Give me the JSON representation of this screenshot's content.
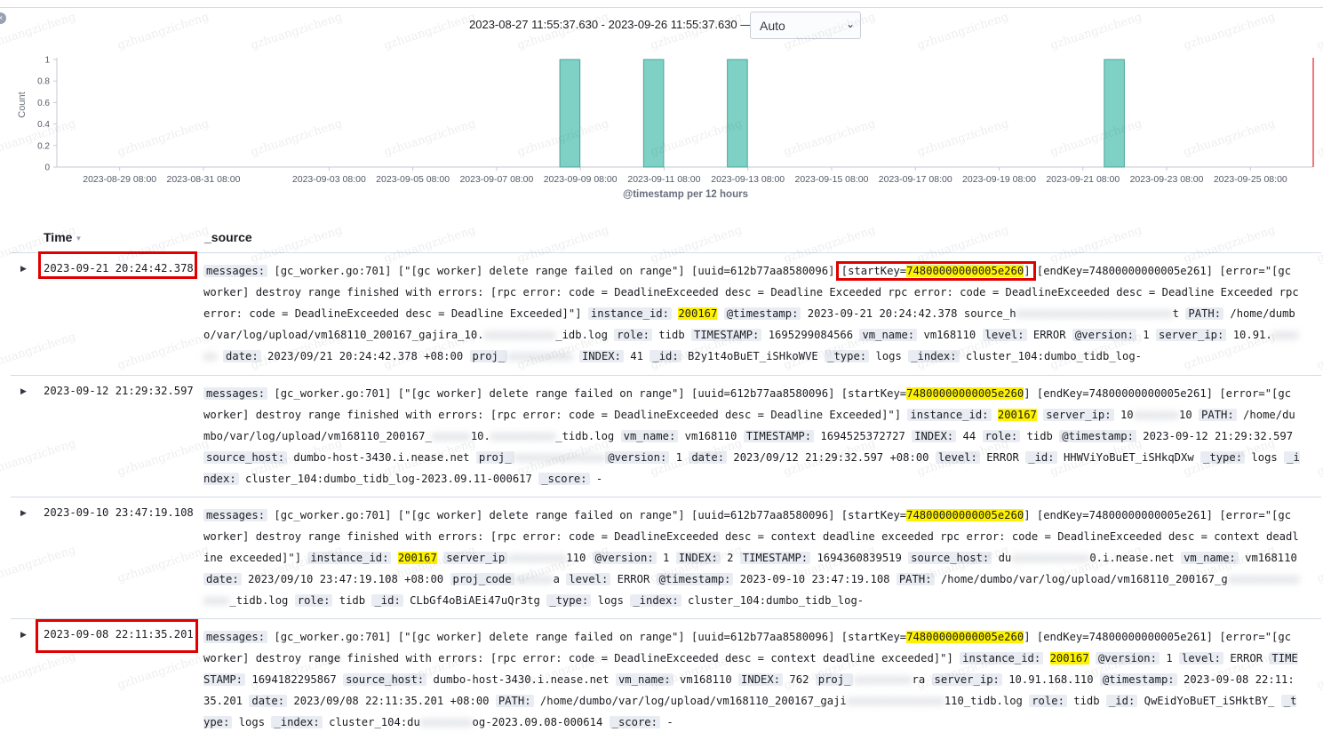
{
  "header": {
    "time_range": "2023-08-27 11:55:37.630 - 2023-09-26 11:55:37.630 —",
    "interval_value": "Auto",
    "clear_glyph": "×"
  },
  "chart_data": {
    "type": "bar",
    "ylabel": "Count",
    "xlabel": "@timestamp per 12 hours",
    "ylim": [
      0,
      1
    ],
    "y_ticks": [
      "0",
      "0.2",
      "0.4",
      "0.6",
      "0.8",
      "1"
    ],
    "x_ticks": [
      "2023-08-29 08:00",
      "2023-08-31 08:00",
      "2023-09-03 08:00",
      "2023-09-05 08:00",
      "2023-09-07 08:00",
      "2023-09-09 08:00",
      "2023-09-11 08:00",
      "2023-09-13 08:00",
      "2023-09-15 08:00",
      "2023-09-17 08:00",
      "2023-09-19 08:00",
      "2023-09-21 08:00",
      "2023-09-23 08:00",
      "2023-09-25 08:00"
    ],
    "bars": [
      {
        "x": "2023-09-08 20:00",
        "value": 1
      },
      {
        "x": "2023-09-10 20:00",
        "value": 1
      },
      {
        "x": "2023-09-12 20:00",
        "value": 1
      },
      {
        "x": "2023-09-21 20:00",
        "value": 1
      }
    ],
    "bar_color": "#7fd1c5",
    "bar_stroke": "#4aa59a",
    "now_line_color": "#f04e4e"
  },
  "table": {
    "columns": {
      "time": "Time",
      "source": "_source"
    },
    "sort_glyph": "▼",
    "expand_glyph": "▶",
    "watermark": "gzhuangzicheng"
  },
  "rows": [
    {
      "time": "2023-09-21 20:24:42.378",
      "messages_a": " [gc_worker.go:701] [\"[gc worker] delete range failed on range\"] [uuid=612b77aa8580096] ",
      "start_prefix": "[startKey=",
      "start_key": "74800000000005e260",
      "start_suffix": "]",
      "messages_b": " [endKey=74800000000005e261] [error=\"[gc worker] destroy range finished with errors: [rpc error: code = DeadlineExceeded desc = Deadline Exceeded rpc error: code = DeadlineExceeded desc = Deadline Exceeded rpc error: code = DeadlineExceeded desc = Deadline Exceeded]\"] ",
      "instance_id": "200167",
      "timestamp": " 2023-09-21 20:24:42.378 ",
      "source_host_partial": "source_h",
      "source_host_tail": "t",
      "path": " /home/dumbo/var/log/upload/vm168110_200167_gajira_10.",
      "path_tail": "_idb.log ",
      "role": " tidb ",
      "ts_num": " 1695299084566 ",
      "vm_name": " vm168110 ",
      "level": " ERROR ",
      "version": " 1 ",
      "server_ip": " 10.91.",
      "date": " 2023/09/21 20:24:42.378 +08:00 ",
      "proj_partial": "proj_",
      "index_num": " 41 ",
      "id": " B2y1t4oBuET_iSHkoWVE ",
      "type": " logs ",
      "index_val": " cluster_104:dumbo_tidb_log-"
    },
    {
      "time": "2023-09-12 21:29:32.597",
      "messages_a": " [gc_worker.go:701] [\"[gc worker] delete range failed on range\"] [uuid=612b77aa8580096] [startKey=",
      "start_key": "74800000000005e260",
      "messages_b": "] [endKey=74800000000005e261] [error=\"[gc worker] destroy range finished with errors: [rpc error: code = DeadlineExceeded desc = Deadline Exceeded]\"] ",
      "instance_id": "200167",
      "server_ip": " 10",
      "server_ip_tail": "10",
      "path": " /home/dumbo/var/log/upload/vm168110_200167_",
      "path_mid": "10.",
      "path_tail": "_tidb.log ",
      "vm_name": " vm168110 ",
      "ts_num": " 1694525372727 ",
      "index_num": " 44 ",
      "role": " tidb ",
      "timestamp": " 2023-09-12 21:29:32.597 ",
      "source_host": " dumbo-host-3430.i.nease.net ",
      "proj_partial": "proj_",
      "version": " 1 ",
      "date": " 2023/09/12 21:29:32.597 +08:00 ",
      "level": " ERROR ",
      "id": " HHWViYoBuET_iSHkqDXw ",
      "type": " logs ",
      "index_val": " cluster_104:dumbo_tidb_log-2023.09.11-000617 ",
      "score": " -"
    },
    {
      "time": "2023-09-10 23:47:19.108",
      "messages_a": " [gc_worker.go:701] [\"[gc worker] delete range failed on range\"] [uuid=612b77aa8580096] [startKey=",
      "start_key": "74800000000005e260",
      "messages_b": "] [endKey=74800000000005e261] [error=\"[gc worker] destroy range finished with errors: [rpc error: code = DeadlineExceeded desc = context deadline exceeded rpc error: code = DeadlineExceeded desc = context deadline exceeded]\"] ",
      "instance_id": "200167",
      "server_ip_partial": "server_ip",
      "server_ip_tail": "110 ",
      "version": " 1 ",
      "index_num": " 2 ",
      "ts_num": " 1694360839519 ",
      "source_host_partial": " du",
      "source_host_tail": "0.i.nease.net ",
      "vm_name": " vm168110",
      "date": " 2023/09/10 23:47:19.108 +08:00 ",
      "proj_partial": "proj_code",
      "proj_tail": "a ",
      "level": " ERROR ",
      "timestamp": " 2023-09-10 23:47:19.108",
      "path": " /home/dumbo/var/log/upload/vm168110_200167_g",
      "path_tail": "_tidb.log ",
      "role": " tidb ",
      "id": " CLbGf4oBiAEi47uQr3tg ",
      "type": " logs ",
      "index_val": " cluster_104:dumbo_tidb_log-"
    },
    {
      "time": "2023-09-08 22:11:35.201",
      "messages_a": " [gc_worker.go:701] [\"[gc worker] delete range failed on range\"] [uuid=612b77aa8580096] [startKey=",
      "start_key": "74800000000005e260",
      "messages_b": "] [endKey=74800000000005e261] [error=\"[gc worker] destroy range finished with errors: [rpc error: code = DeadlineExceeded desc = context deadline exceeded]\"] ",
      "instance_id": "200167",
      "version": " 1 ",
      "level": " ERROR",
      "ts_num": " 1694182295867 ",
      "source_host": " dumbo-host-3430.i.nease.net ",
      "vm_name": " vm168110 ",
      "index_num": " 762 ",
      "proj_partial": "proj_",
      "proj_tail": "ra ",
      "server_ip": " 10.91.168.110 ",
      "timestamp": " 2023-09-08 22:11:35.201 ",
      "date": " 2023/09/08 22:11:35.201 +08:00 ",
      "path": " /home/dumbo/var/log/upload/vm168110_200167_gaji",
      "path_tail": "110_tidb.log ",
      "role": " tidb ",
      "id": " QwEidYoBuET_iSHktBY_",
      "type": " logs ",
      "index_val": " cluster_104:du",
      "index_tail": "og-2023.09.08-000614 ",
      "score": " -"
    }
  ],
  "keys": {
    "messages": "messages:",
    "instance_id": "instance_id:",
    "timestamp": "@timestamp:",
    "path": "PATH:",
    "role": "role:",
    "ts": "TIMESTAMP:",
    "vm_name": "vm_name:",
    "level": "level:",
    "version": "@version:",
    "server_ip": "server_ip:",
    "date": "date:",
    "index_num": "INDEX:",
    "id": "_id:",
    "type": "_type:",
    "index": "_index:",
    "source_host": "source_host:",
    "score": "_score:"
  }
}
